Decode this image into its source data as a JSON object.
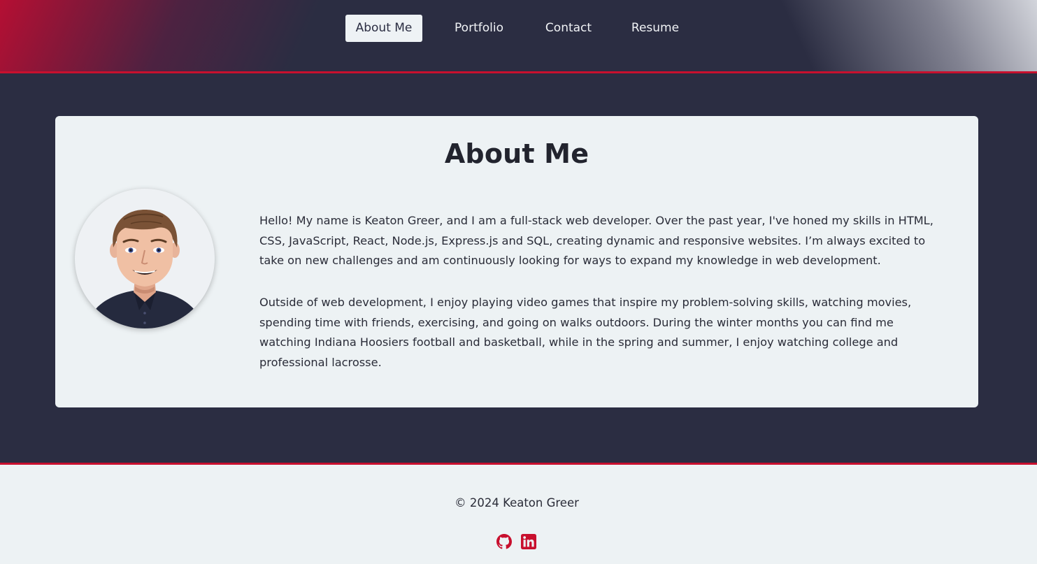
{
  "nav": {
    "items": [
      {
        "label": "About Me",
        "active": true
      },
      {
        "label": "Portfolio",
        "active": false
      },
      {
        "label": "Contact",
        "active": false
      },
      {
        "label": "Resume",
        "active": false
      }
    ]
  },
  "about": {
    "title": "About Me",
    "avatar_alt": "Cartoon avatar of Keaton Greer",
    "paragraphs": [
      "Hello! My name is Keaton Greer, and I am a full-stack web developer. Over the past year, I've honed my skills in HTML, CSS, JavaScript, React, Node.js, Express.js and SQL, creating dynamic and responsive websites. I’m always excited to take on new challenges and am continuously looking for ways to expand my knowledge in web development.",
      "Outside of web development, I enjoy playing video games that inspire my problem-solving skills, watching movies, spending time with friends, exercising, and going on walks outdoors. During the winter months you can find me watching Indiana Hoosiers football and basketball, while in the spring and summer, I enjoy watching college and professional lacrosse."
    ]
  },
  "footer": {
    "copyright": "© 2024 Keaton Greer",
    "social": [
      {
        "icon": "github-icon",
        "color": "#c8102e"
      },
      {
        "icon": "linkedin-icon",
        "color": "#c8102e"
      }
    ]
  },
  "colors": {
    "background": "#2b2d42",
    "accent": "#c8102e",
    "card": "#edf2f4"
  }
}
